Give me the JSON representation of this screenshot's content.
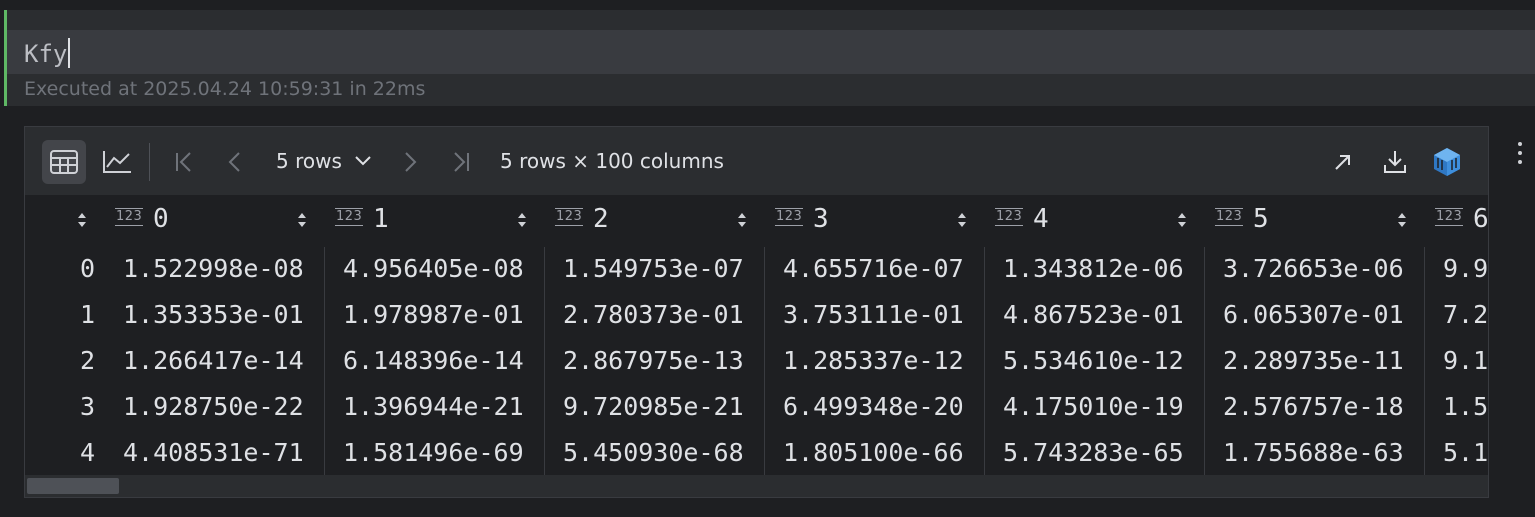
{
  "cell": {
    "code": "Kfy",
    "status": "Executed at 2025.04.24 10:59:31 in 22ms"
  },
  "toolbar": {
    "rows_select": "5 rows",
    "summary": "5 rows × 100 columns",
    "icons": [
      "table-view-icon",
      "chart-view-icon",
      "first-page-icon",
      "previous-page-icon",
      "next-page-icon",
      "last-page-icon",
      "open-in-new-icon",
      "download-icon",
      "data-wrangler-icon"
    ]
  },
  "table": {
    "columns": [
      "0",
      "1",
      "2",
      "3",
      "4",
      "5",
      "6"
    ],
    "type_badge": "123",
    "rows": [
      {
        "index": "0",
        "values": [
          "1.522998e-08",
          "4.956405e-08",
          "1.549753e-07",
          "4.655716e-07",
          "1.343812e-06",
          "3.726653e-06",
          "9.9"
        ]
      },
      {
        "index": "1",
        "values": [
          "1.353353e-01",
          "1.978987e-01",
          "2.780373e-01",
          "3.753111e-01",
          "4.867523e-01",
          "6.065307e-01",
          "7.2"
        ]
      },
      {
        "index": "2",
        "values": [
          "1.266417e-14",
          "6.148396e-14",
          "2.867975e-13",
          "1.285337e-12",
          "5.534610e-12",
          "2.289735e-11",
          "9.1"
        ]
      },
      {
        "index": "3",
        "values": [
          "1.928750e-22",
          "1.396944e-21",
          "9.720985e-21",
          "6.499348e-20",
          "4.175010e-19",
          "2.576757e-18",
          "1.5"
        ]
      },
      {
        "index": "4",
        "values": [
          "4.408531e-71",
          "1.581496e-69",
          "5.450930e-68",
          "1.805100e-66",
          "5.743283e-65",
          "1.755688e-63",
          "5.1"
        ]
      }
    ]
  },
  "colors": {
    "accent_green": "#5fb865",
    "background": "#1e1f22",
    "panel": "#2b2d30",
    "text": "#dfe1e5",
    "muted": "#6f737a"
  }
}
